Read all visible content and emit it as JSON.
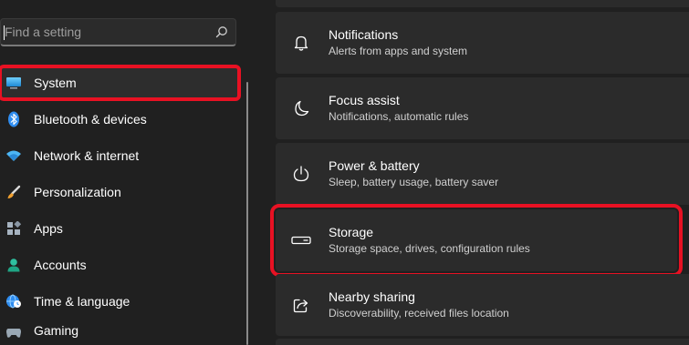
{
  "search": {
    "placeholder": "Find a setting",
    "icon": "search-icon"
  },
  "nav": {
    "items": [
      {
        "label": "System",
        "icon": "monitor-icon",
        "selected": true
      },
      {
        "label": "Bluetooth & devices",
        "icon": "bluetooth-icon"
      },
      {
        "label": "Network & internet",
        "icon": "wifi-icon"
      },
      {
        "label": "Personalization",
        "icon": "paintbrush-icon"
      },
      {
        "label": "Apps",
        "icon": "apps-icon"
      },
      {
        "label": "Accounts",
        "icon": "person-icon"
      },
      {
        "label": "Time & language",
        "icon": "globe-clock-icon"
      },
      {
        "label": "Gaming",
        "icon": "gamepad-icon"
      }
    ]
  },
  "settings": {
    "items": [
      {
        "title": "Notifications",
        "description": "Alerts from apps and system",
        "icon": "bell-icon"
      },
      {
        "title": "Focus assist",
        "description": "Notifications, automatic rules",
        "icon": "moon-icon"
      },
      {
        "title": "Power & battery",
        "description": "Sleep, battery usage, battery saver",
        "icon": "power-icon"
      },
      {
        "title": "Storage",
        "description": "Storage space, drives, configuration rules",
        "icon": "storage-drive-icon",
        "highlighted": true
      },
      {
        "title": "Nearby sharing",
        "description": "Discoverability, received files location",
        "icon": "share-icon"
      }
    ]
  },
  "colors": {
    "background": "#202020",
    "card": "#2b2b2b",
    "highlight_outline": "#e81123",
    "accent": "#4cc2ff"
  }
}
